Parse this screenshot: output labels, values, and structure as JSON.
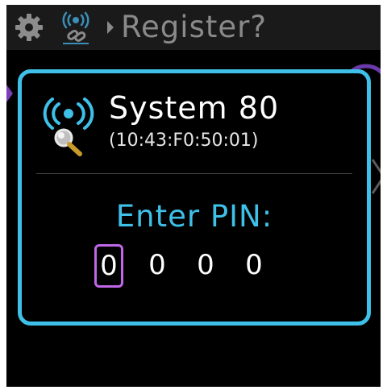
{
  "header": {
    "title": "Register?",
    "icons": [
      "gear-icon",
      "wireless-link-icon",
      "breadcrumb-arrow-icon"
    ]
  },
  "dialog": {
    "device_name": "System 80",
    "device_address": "(10:43:F0:50:01)",
    "device_icon": "wireless-search-icon",
    "prompt": "Enter PIN:",
    "pin_digits": [
      "0",
      "0",
      "0",
      "0"
    ],
    "active_digit_index": 0
  },
  "colors": {
    "accent_blue": "#3fc0e8",
    "focus_purple": "#c066e8",
    "header_text": "#8a8a8a",
    "background": "#000000"
  }
}
